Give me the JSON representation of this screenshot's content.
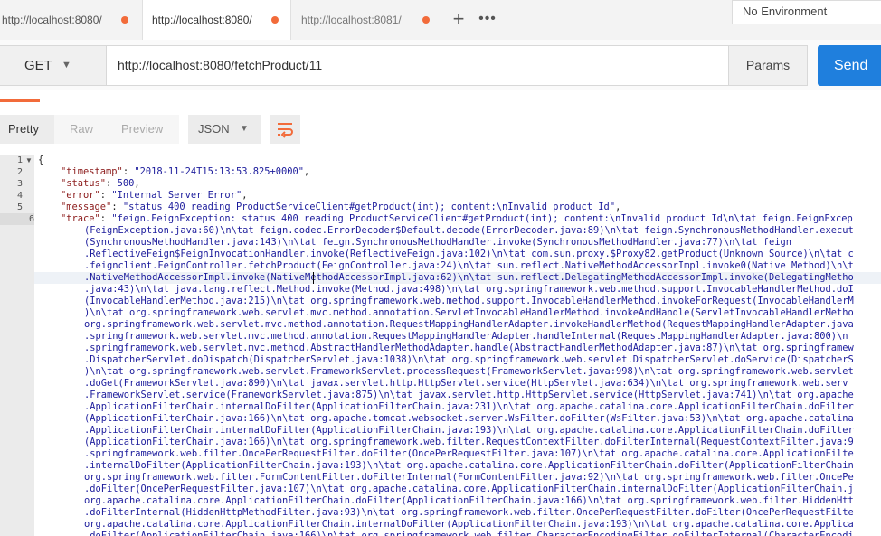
{
  "tabs": [
    {
      "label": "http://localhost:8080/​"
    },
    {
      "label": "http://localhost:8080/​"
    },
    {
      "label": "http://localhost:8081/​"
    }
  ],
  "new_tab_icon": "plus-icon",
  "more_tabs_icon": "ellipsis-icon",
  "environment": "No Environment",
  "request": {
    "method": "GET",
    "url": "http://localhost:8080/fetchProduct/11",
    "params_label": "Params",
    "send_label": "Send"
  },
  "response_view": {
    "pretty": "Pretty",
    "raw": "Raw",
    "preview": "Preview",
    "format": "JSON"
  },
  "colors": {
    "accent": "#f26b3a",
    "send": "#1f7fdd"
  },
  "body": {
    "line_numbers": [
      "1",
      "2",
      "3",
      "4",
      "5",
      "6"
    ],
    "open_brace": "{",
    "timestamp_key": "\"timestamp\"",
    "timestamp_val": "\"2018-11-24T15:13:53.825+0000\"",
    "status_key": "\"status\"",
    "status_val": "500",
    "error_key": "\"error\"",
    "error_val": "\"Internal Server Error\"",
    "message_key": "\"message\"",
    "message_val": "\"status 400 reading ProductServiceClient#getProduct(int); content:\\nInvalid product Id\"",
    "trace_key": "\"trace\"",
    "trace_lines": [
      "\"feign.FeignException: status 400 reading ProductServiceClient#getProduct(int); content:\\nInvalid product Id\\n\\tat feign.FeignExcep",
      "(FeignException.java:60)\\n\\tat feign.codec.ErrorDecoder$Default.decode(ErrorDecoder.java:89)\\n\\tat feign.SynchronousMethodHandler.execut",
      "(SynchronousMethodHandler.java:143)\\n\\tat feign.SynchronousMethodHandler.invoke(SynchronousMethodHandler.java:77)\\n\\tat feign",
      ".ReflectiveFeign$FeignInvocationHandler.invoke(ReflectiveFeign.java:102)\\n\\tat com.sun.proxy.$Proxy82.getProduct(Unknown Source)\\n\\tat c",
      ".feignclient.FeignController.fetchProduct(FeignController.java:24)\\n\\tat sun.reflect.NativeMethodAccessorImpl.invoke0(Native Method)\\n\\t",
      ".NativeMethodAccessorImpl.invoke(NativeMethodAccessorImpl.java:62)\\n\\tat sun.reflect.DelegatingMethodAccessorImpl.invoke(DelegatingMetho",
      ".java:43)\\n\\tat java.lang.reflect.Method.invoke(Method.java:498)\\n\\tat org.springframework.web.method.support.InvocableHandlerMethod.doI",
      "(InvocableHandlerMethod.java:215)\\n\\tat org.springframework.web.method.support.InvocableHandlerMethod.invokeForRequest(InvocableHandlerM",
      ")\\n\\tat org.springframework.web.servlet.mvc.method.annotation.ServletInvocableHandlerMethod.invokeAndHandle(ServletInvocableHandlerMetho",
      "org.springframework.web.servlet.mvc.method.annotation.RequestMappingHandlerAdapter.invokeHandlerMethod(RequestMappingHandlerAdapter.java",
      ".springframework.web.servlet.mvc.method.annotation.RequestMappingHandlerAdapter.handleInternal(RequestMappingHandlerAdapter.java:800)\\n",
      ".springframework.web.servlet.mvc.method.AbstractHandlerMethodAdapter.handle(AbstractHandlerMethodAdapter.java:87)\\n\\tat org.springframew",
      ".DispatcherServlet.doDispatch(DispatcherServlet.java:1038)\\n\\tat org.springframework.web.servlet.DispatcherServlet.doService(DispatcherS",
      ")\\n\\tat org.springframework.web.servlet.FrameworkServlet.processRequest(FrameworkServlet.java:998)\\n\\tat org.springframework.web.servlet",
      ".doGet(FrameworkServlet.java:890)\\n\\tat javax.servlet.http.HttpServlet.service(HttpServlet.java:634)\\n\\tat org.springframework.web.serv",
      ".FrameworkServlet.service(FrameworkServlet.java:875)\\n\\tat javax.servlet.http.HttpServlet.service(HttpServlet.java:741)\\n\\tat org.apache",
      ".ApplicationFilterChain.internalDoFilter(ApplicationFilterChain.java:231)\\n\\tat org.apache.catalina.core.ApplicationFilterChain.doFilter",
      "(ApplicationFilterChain.java:166)\\n\\tat org.apache.tomcat.websocket.server.WsFilter.doFilter(WsFilter.java:53)\\n\\tat org.apache.catalina",
      ".ApplicationFilterChain.internalDoFilter(ApplicationFilterChain.java:193)\\n\\tat org.apache.catalina.core.ApplicationFilterChain.doFilter",
      "(ApplicationFilterChain.java:166)\\n\\tat org.springframework.web.filter.RequestContextFilter.doFilterInternal(RequestContextFilter.java:9",
      ".springframework.web.filter.OncePerRequestFilter.doFilter(OncePerRequestFilter.java:107)\\n\\tat org.apache.catalina.core.ApplicationFilte",
      ".internalDoFilter(ApplicationFilterChain.java:193)\\n\\tat org.apache.catalina.core.ApplicationFilterChain.doFilter(ApplicationFilterChain",
      "org.springframework.web.filter.FormContentFilter.doFilterInternal(FormContentFilter.java:92)\\n\\tat org.springframework.web.filter.OncePe",
      ".doFilter(OncePerRequestFilter.java:107)\\n\\tat org.apache.catalina.core.ApplicationFilterChain.internalDoFilter(ApplicationFilterChain.j",
      "org.apache.catalina.core.ApplicationFilterChain.doFilter(ApplicationFilterChain.java:166)\\n\\tat org.springframework.web.filter.HiddenHtt",
      ".doFilterInternal(HiddenHttpMethodFilter.java:93)\\n\\tat org.springframework.web.filter.OncePerRequestFilter.doFilter(OncePerRequestFilte",
      "org.apache.catalina.core.ApplicationFilterChain.internalDoFilter(ApplicationFilterChain.java:193)\\n\\tat org.apache.catalina.core.Applica",
      ".doFilter(ApplicationFilterChain.java:166)\\n\\tat org.springframework.web.filter.CharacterEncodingFilter.doFilterInternal(CharacterEncodi"
    ]
  }
}
